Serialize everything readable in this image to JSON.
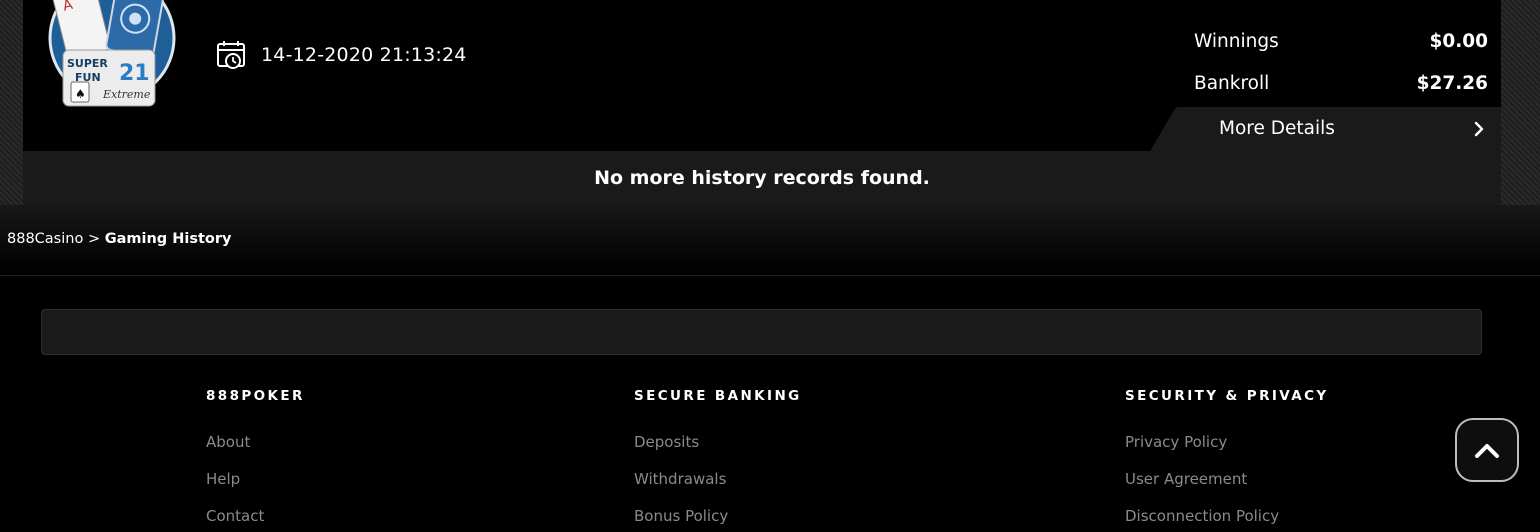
{
  "record": {
    "logo_name": "Super Fun 21 Extreme",
    "logo_text_1": "SUPER",
    "logo_text_2": "FUN",
    "logo_text_3": "21",
    "logo_text_4": "Extreme",
    "datetime": "14-12-2020 21:13:24",
    "stats": [
      {
        "label": "Winnings",
        "value": "$0.00"
      },
      {
        "label": "Bankroll",
        "value": "$27.26"
      }
    ],
    "more_details_label": "More Details"
  },
  "no_more_records": "No more history records found.",
  "breadcrumb": {
    "root": "888Casino",
    "separator": ">",
    "current": "Gaming History"
  },
  "footer": {
    "columns": [
      {
        "heading": "888POKER",
        "links": [
          "About",
          "Help",
          "Contact"
        ]
      },
      {
        "heading": "SECURE BANKING",
        "links": [
          "Deposits",
          "Withdrawals",
          "Bonus Policy"
        ]
      },
      {
        "heading": "SECURITY & PRIVACY",
        "links": [
          "Privacy Policy",
          "User Agreement",
          "Disconnection Policy"
        ]
      }
    ]
  },
  "icons": {
    "calendar": "calendar-clock-icon",
    "chevron": "chevron-right-icon",
    "scroll_top": "chevron-up-icon"
  },
  "colors": {
    "background": "#000000",
    "panel": "#1a1a1a",
    "footer_link": "#8a8a8a"
  }
}
